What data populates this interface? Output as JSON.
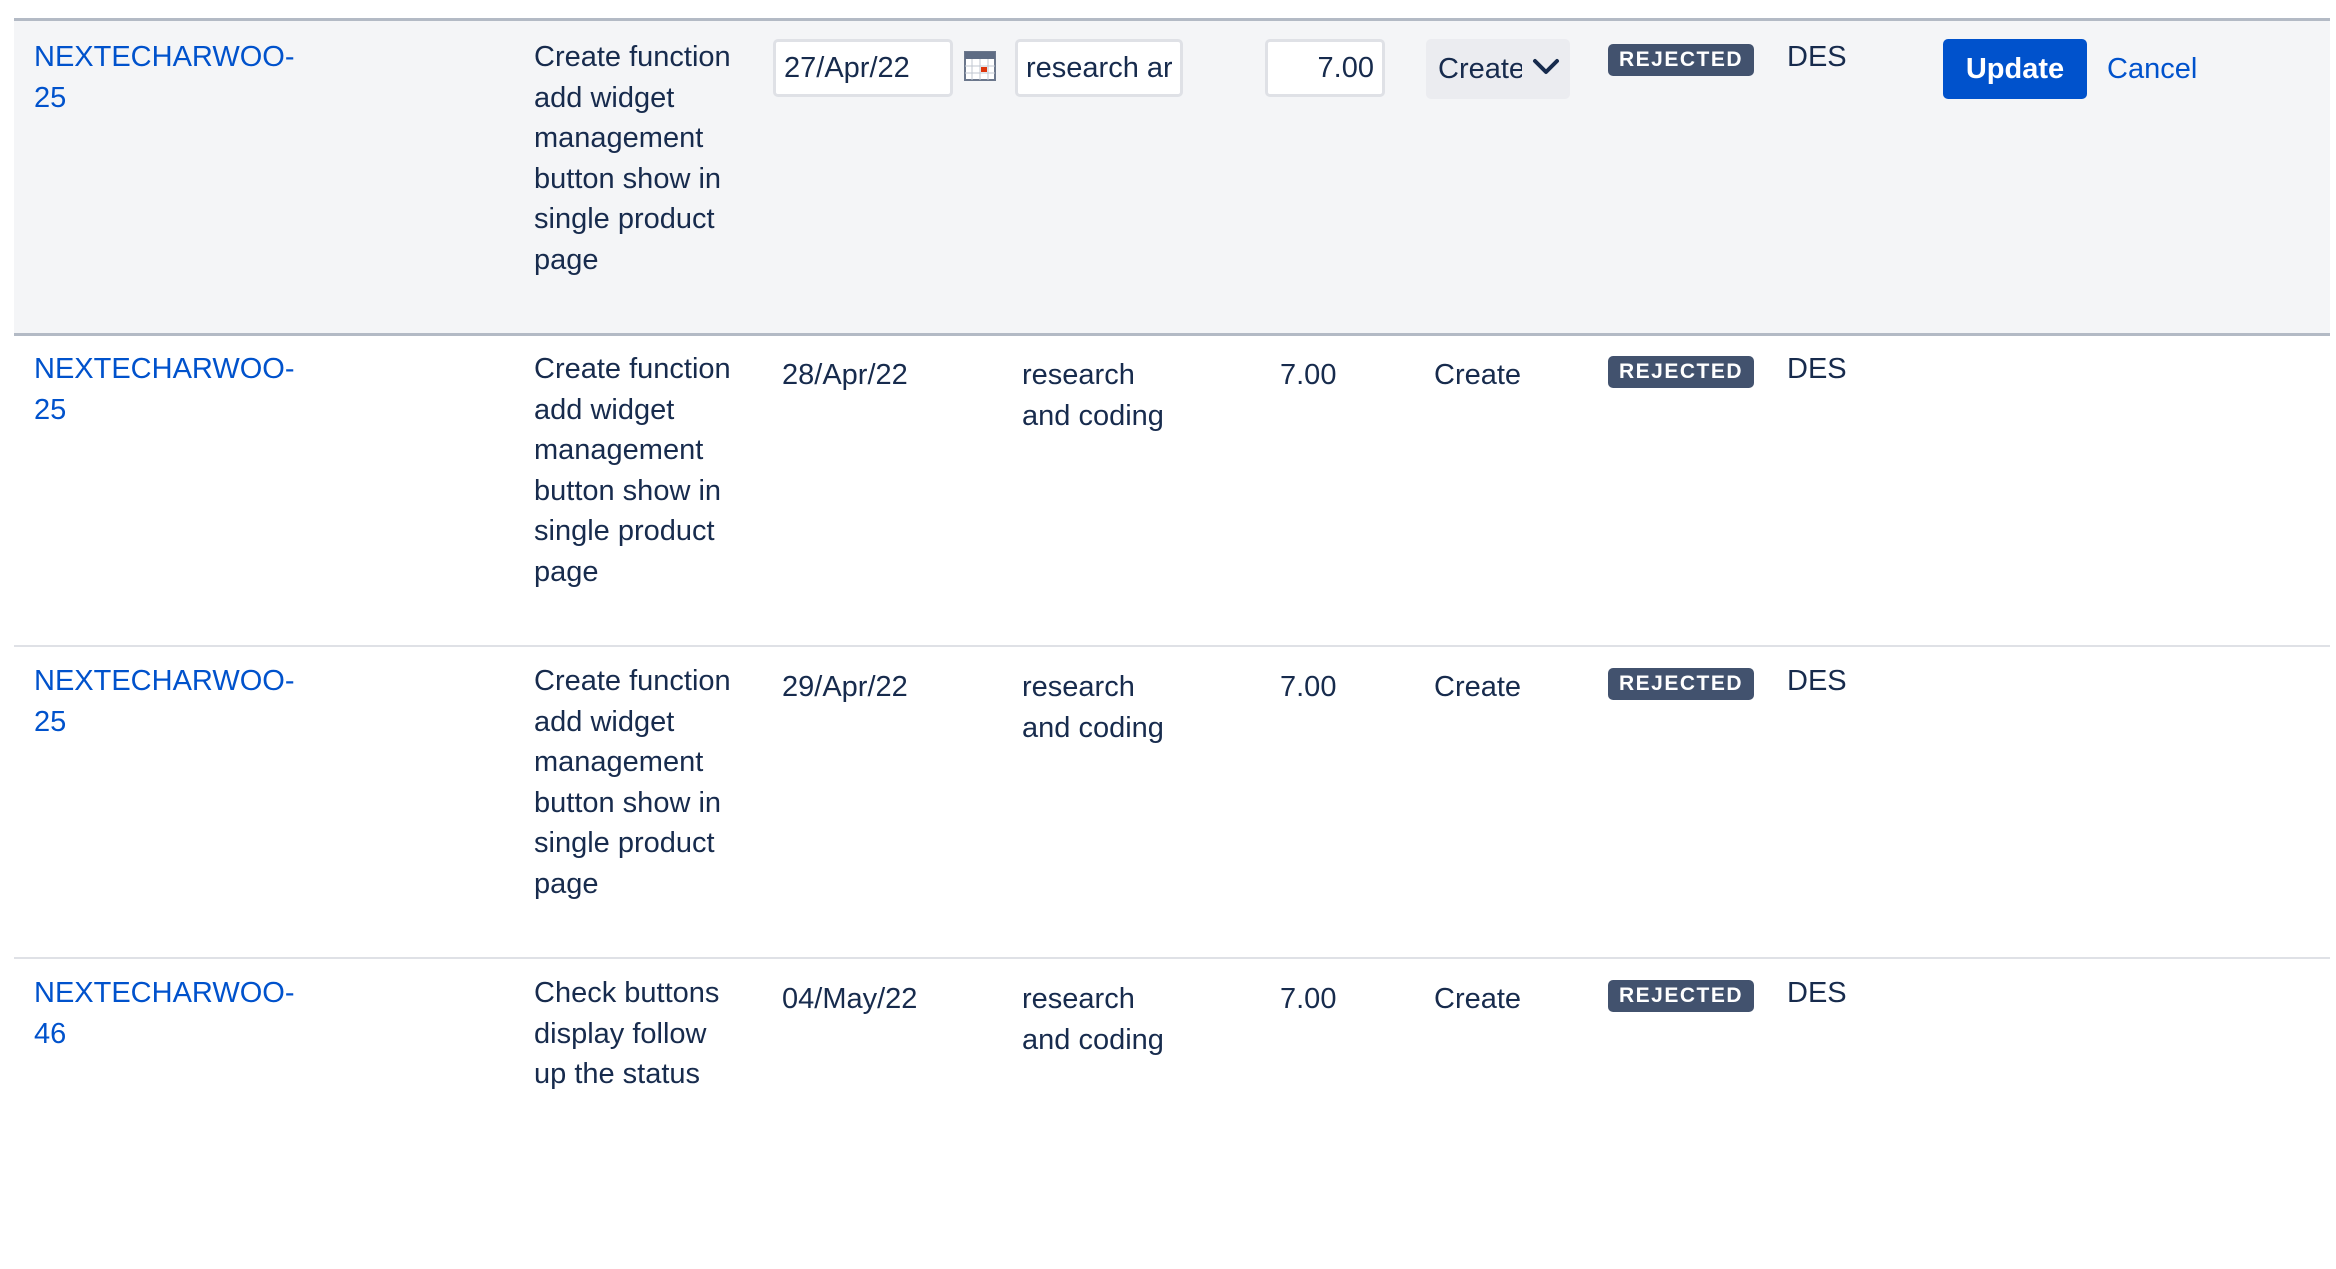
{
  "edit_row": {
    "key": "NEXTECHARWOO-25",
    "summary": "Create function add widget management button show in single product page",
    "date_value": "27/Apr/22",
    "comment_value": "research ar",
    "hours_value": "7.00",
    "type_value": "Create",
    "status": "REJECTED",
    "dept": "DES",
    "update_label": "Update",
    "cancel_label": "Cancel",
    "icons": [
      "calendar-icon",
      "chevron-down-icon"
    ]
  },
  "rows": [
    {
      "key": "NEXTECHARWOO-25",
      "summary": "Create function add widget management button show in single product page",
      "date": "28/Apr/22",
      "comment": "research and coding",
      "hours": "7.00",
      "type": "Create",
      "status": "REJECTED",
      "dept": "DES"
    },
    {
      "key": "NEXTECHARWOO-25",
      "summary": "Create function add widget management button show in single product page",
      "date": "29/Apr/22",
      "comment": "research and coding",
      "hours": "7.00",
      "type": "Create",
      "status": "REJECTED",
      "dept": "DES"
    },
    {
      "key": "NEXTECHARWOO-46",
      "summary": "Check buttons display follow up the status",
      "date": "04/May/22",
      "comment": "research and coding",
      "hours": "7.00",
      "type": "Create",
      "status": "REJECTED",
      "dept": "DES"
    }
  ],
  "colors": {
    "link": "#0052cc",
    "status_badge": "#42526e",
    "edit_row_bg": "#f4f5f7",
    "primary_button": "#0052cc"
  }
}
